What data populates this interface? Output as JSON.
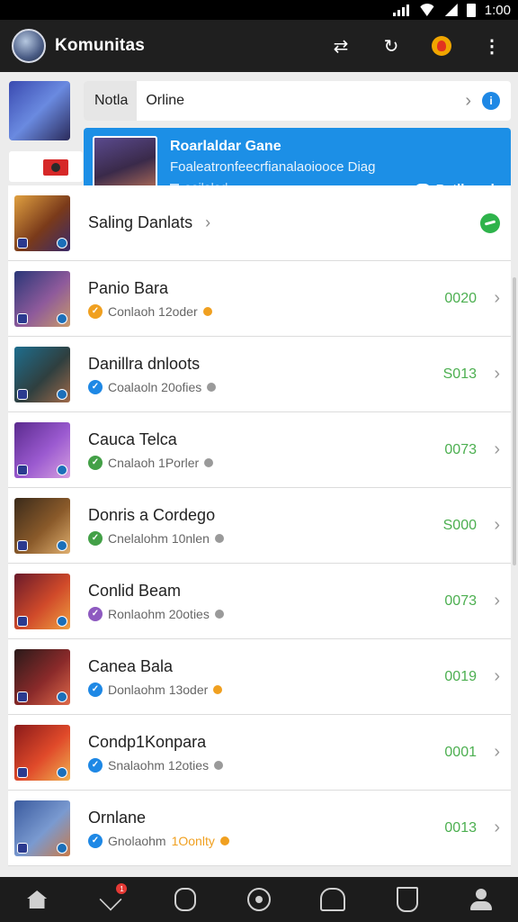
{
  "statusbar": {
    "time": "1:00"
  },
  "appbar": {
    "title": "Komunitas",
    "icons": [
      "share-icon",
      "refresh-icon",
      "notification-icon",
      "more-icon"
    ]
  },
  "tabs": {
    "active": "Notla",
    "second": "Orline"
  },
  "feature": {
    "title": "Roarlaldar Gane",
    "subtitle": "Foaleatronfeecrfianalaoiooce Diag",
    "status": "eoilalod",
    "button": "Petlkeack"
  },
  "list": {
    "header": {
      "label": "Saling Danlats"
    },
    "items": [
      {
        "name": "Panio Bara",
        "meta": "Conlaoh 12oder",
        "count": "0020",
        "dot_color": "#f0a020",
        "tail": "orange",
        "art": [
          "#2a3778",
          "#8e5a9b",
          "#c89a6a"
        ]
      },
      {
        "name": "Danillra dnloots",
        "meta": "Coalaoln 20ofies",
        "count": "S013",
        "dot_color": "#1e88e5",
        "tail": "gray",
        "art": [
          "#1e6e8e",
          "#2f3f3f",
          "#a06a4a"
        ]
      },
      {
        "name": "Cauca Telca",
        "meta": "Cnalaoh 1Porler",
        "count": "0073",
        "dot_color": "#43a047",
        "tail": "gray",
        "art": [
          "#5a2a8e",
          "#9b5ad0",
          "#d6a0e0"
        ]
      },
      {
        "name": "Donris a Cordego",
        "meta": "Cnelalohm 10nlen",
        "count": "S000",
        "dot_color": "#43a047",
        "tail": "gray",
        "art": [
          "#3a2a1a",
          "#8a5a2a",
          "#e0b070"
        ]
      },
      {
        "name": "Conlid Beam",
        "meta": "Ronlaohm 20oties",
        "count": "0073",
        "dot_color": "#8e5ac0",
        "tail": "gray",
        "art": [
          "#6a1a2a",
          "#d04a2a",
          "#f0a040"
        ]
      },
      {
        "name": "Canea Bala",
        "meta": "Donlaohm 13oder",
        "count": "0019",
        "dot_color": "#1e88e5",
        "tail": "orange",
        "art": [
          "#2a1a1a",
          "#8a2a2a",
          "#e06a4a"
        ]
      },
      {
        "name": "Condp1Konpara",
        "meta": "Snalaohm 12oties",
        "count": "0001",
        "dot_color": "#1e88e5",
        "tail": "gray",
        "art": [
          "#8a1a1a",
          "#e04a2a",
          "#f0b050"
        ]
      },
      {
        "name": "Ornlane",
        "meta": "Gnolaohm",
        "meta_highlight": "1Oonlty",
        "count": "0013",
        "dot_color": "#1e88e5",
        "tail": "orange",
        "art": [
          "#3a5a9e",
          "#7a9ad0",
          "#c87a4a"
        ]
      }
    ]
  },
  "bottom_nav": {
    "badge": "1",
    "icons": [
      "home-icon",
      "checkin-icon",
      "link-icon",
      "eye-icon",
      "profile-card-icon",
      "document-icon",
      "user-icon"
    ]
  },
  "colors": {
    "accent": "#1c8fe6",
    "count_green": "#4caf50",
    "appbar": "#1f1f1f"
  }
}
